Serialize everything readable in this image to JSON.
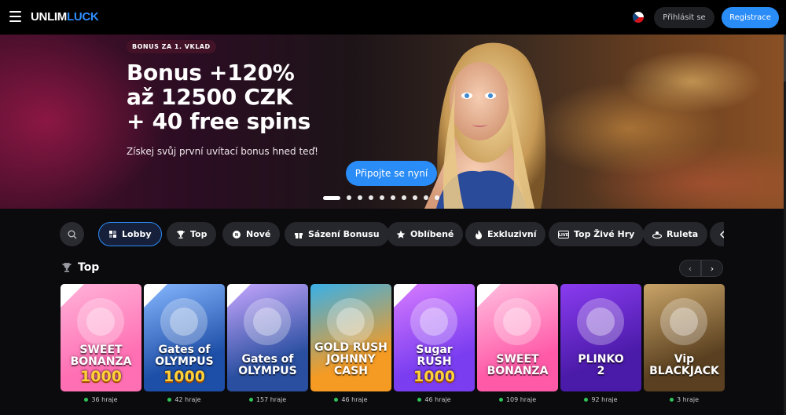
{
  "header": {
    "logo_a": "UNLIM",
    "logo_b": "LUCK",
    "login": "Přihlásit se",
    "register": "Registrace"
  },
  "hero": {
    "badge": "BONUS ZA 1. VKLAD",
    "title_1": "Bonus +120%",
    "title_2": "až 12500 CZK",
    "title_3": "+ 40 free spins",
    "subtitle": "Získej svůj první uvítací bonus hned teď!",
    "cta": "Připojte se nyní",
    "slides": 10,
    "active_slide": 1
  },
  "filters": [
    {
      "label": "Lobby",
      "icon": "lobby-icon",
      "active": true
    },
    {
      "label": "Top",
      "icon": "trophy-icon"
    },
    {
      "label": "Nové",
      "icon": "new-icon"
    },
    {
      "label": "Sázení Bonusu",
      "icon": "gift-icon"
    },
    {
      "label": "Oblíbené",
      "icon": "star-icon"
    },
    {
      "label": "Exkluzivní",
      "icon": "flame-icon"
    },
    {
      "label": "Top Živé Hry",
      "icon": "live-icon"
    },
    {
      "label": "Ruleta",
      "icon": "roulette-icon"
    }
  ],
  "section": {
    "title": "Top"
  },
  "games": [
    {
      "line1": "SWEET",
      "line2": "BONANZA",
      "big": "1000",
      "players": "36 hraje",
      "drops": true,
      "bg1": "#ff6fb3",
      "bg2": "#ffb3d9"
    },
    {
      "line1": "Gates of",
      "line2": "OLYMPUS",
      "big": "1000",
      "players": "42 hraje",
      "drops": true,
      "bg1": "#1e4fa8",
      "bg2": "#86b7ff"
    },
    {
      "line1": "Gates of",
      "line2": "OLYMPUS",
      "big": "",
      "players": "157 hraje",
      "drops": true,
      "bg1": "#2a4fa0",
      "bg2": "#c7a7ff"
    },
    {
      "line1": "GOLD RUSH",
      "line2": "JOHNNY CASH",
      "big": "",
      "players": "46 hraje",
      "drops": false,
      "bg1": "#f59b23",
      "bg2": "#39b0e8"
    },
    {
      "line1": "Sugar",
      "line2": "RUSH",
      "big": "1000",
      "players": "46 hraje",
      "drops": true,
      "bg1": "#7a3df0",
      "bg2": "#d77bff"
    },
    {
      "line1": "SWEET",
      "line2": "BONANZA",
      "big": "",
      "players": "109 hraje",
      "drops": true,
      "bg1": "#ff5aa8",
      "bg2": "#ffc0e0"
    },
    {
      "line1": "PLINKO",
      "line2": "2",
      "big": "",
      "players": "92 hraje",
      "drops": false,
      "bg1": "#4a1aa8",
      "bg2": "#8a3cf0"
    },
    {
      "line1": "Vip",
      "line2": "BLACKJACK",
      "big": "",
      "players": "3 hraje",
      "drops": false,
      "bg1": "#5a4020",
      "bg2": "#c9a468"
    }
  ]
}
